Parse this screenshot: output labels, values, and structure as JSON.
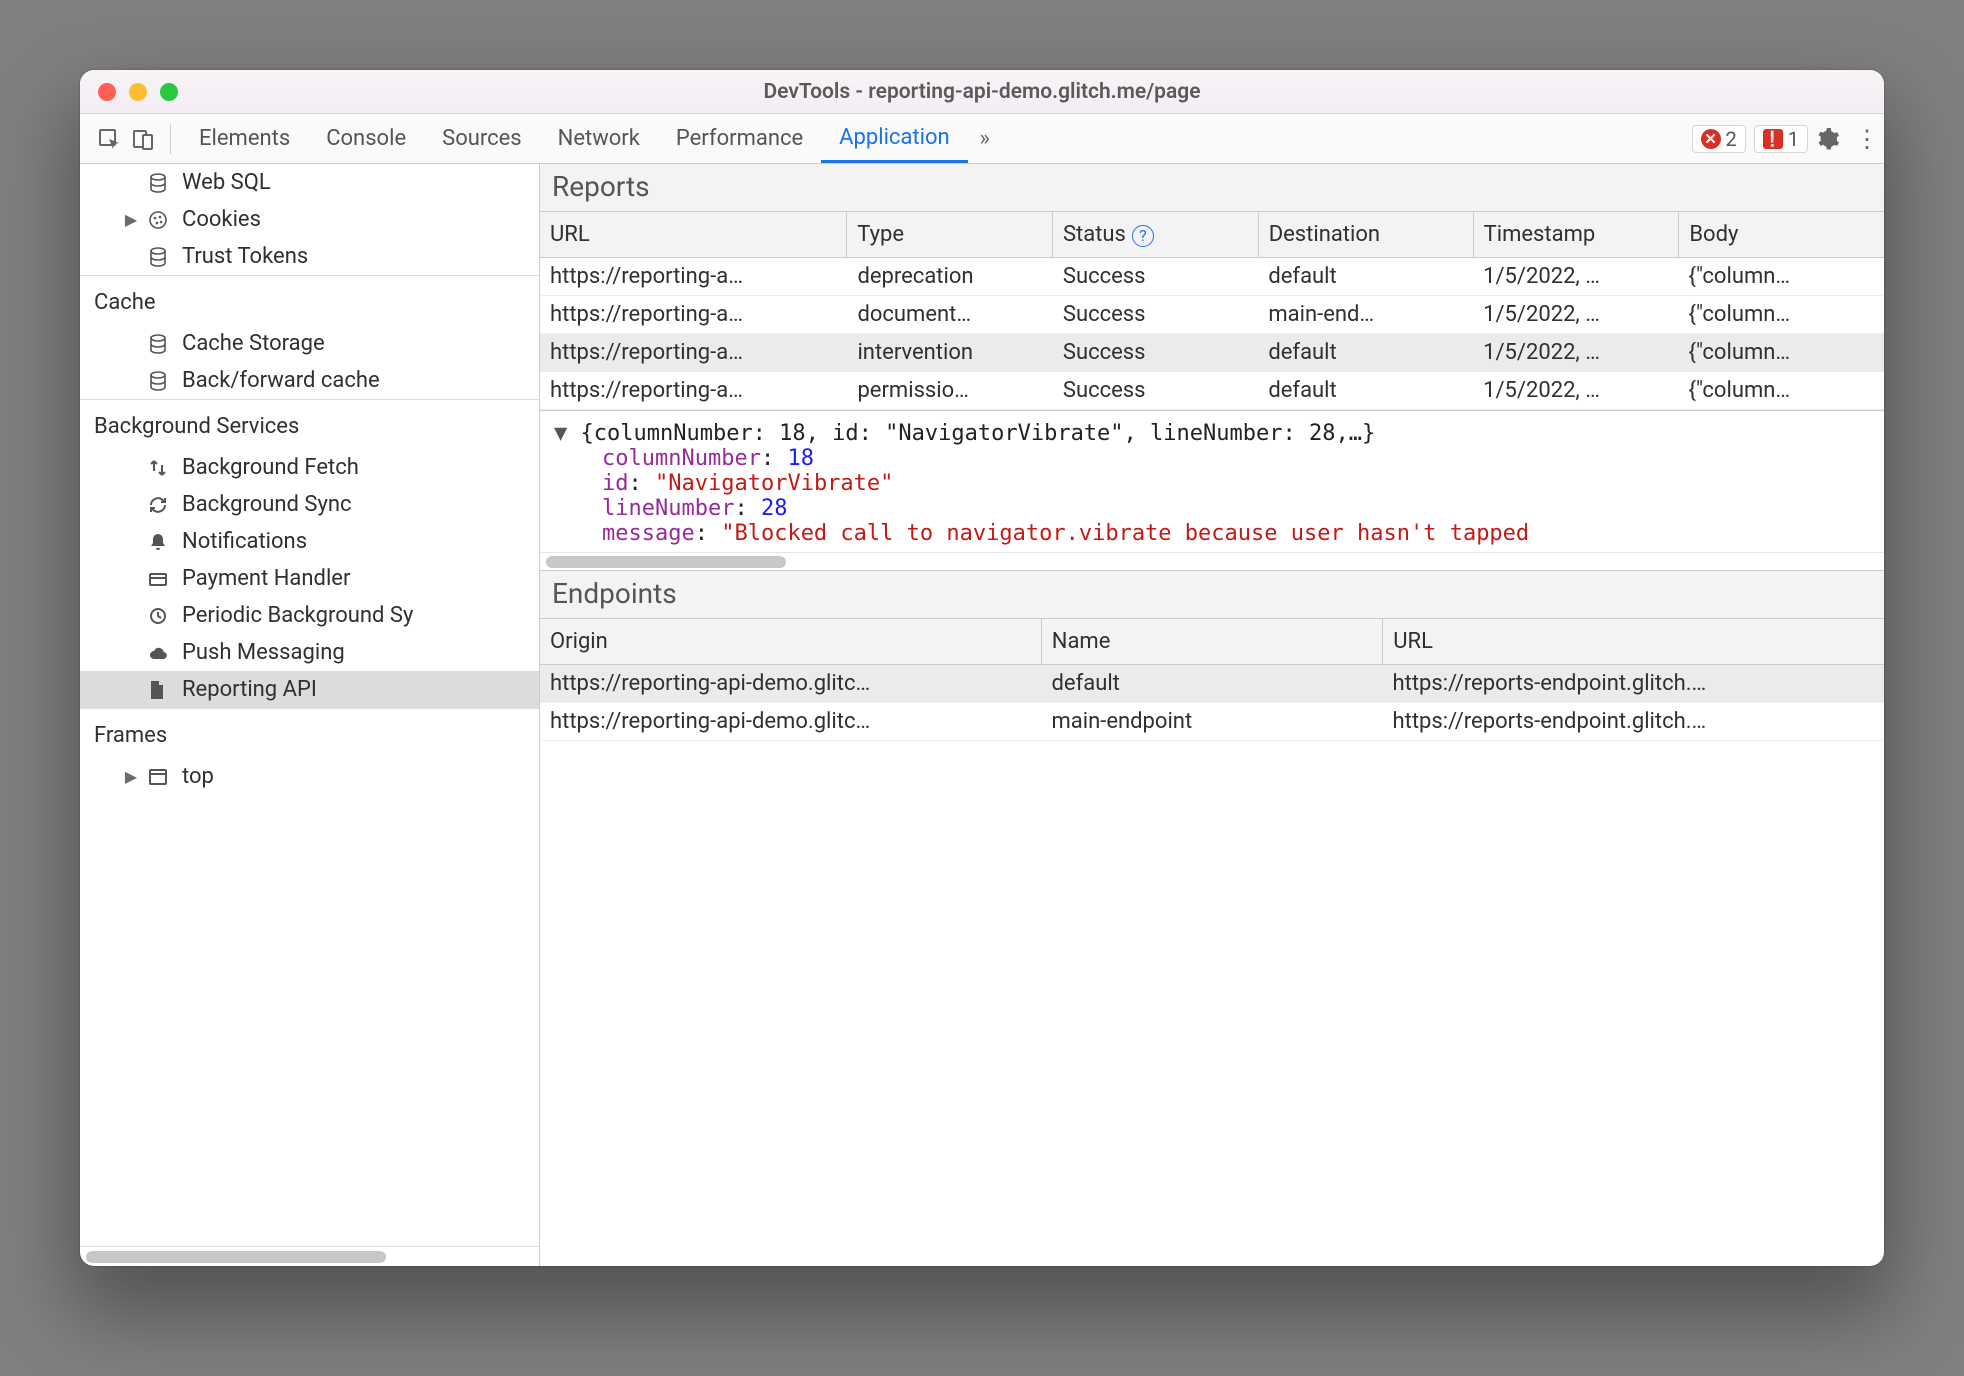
{
  "window": {
    "title": "DevTools - reporting-api-demo.glitch.me/page"
  },
  "toolbar": {
    "tabs": [
      "Elements",
      "Console",
      "Sources",
      "Network",
      "Performance",
      "Application"
    ],
    "active_tab": "Application",
    "errors_count": "2",
    "issues_count": "1"
  },
  "sidebar": {
    "top_items": [
      {
        "icon": "database-icon",
        "label": "Web SQL"
      },
      {
        "icon": "cookie-icon",
        "label": "Cookies",
        "expandable": true
      },
      {
        "icon": "database-icon",
        "label": "Trust Tokens"
      }
    ],
    "groups": [
      {
        "title": "Cache",
        "items": [
          {
            "icon": "database-icon",
            "label": "Cache Storage"
          },
          {
            "icon": "database-icon",
            "label": "Back/forward cache"
          }
        ]
      },
      {
        "title": "Background Services",
        "items": [
          {
            "icon": "updown-icon",
            "label": "Background Fetch"
          },
          {
            "icon": "sync-icon",
            "label": "Background Sync"
          },
          {
            "icon": "bell-icon",
            "label": "Notifications"
          },
          {
            "icon": "card-icon",
            "label": "Payment Handler"
          },
          {
            "icon": "clock-icon",
            "label": "Periodic Background Sy"
          },
          {
            "icon": "cloud-icon",
            "label": "Push Messaging"
          },
          {
            "icon": "file-icon",
            "label": "Reporting API",
            "selected": true
          }
        ]
      },
      {
        "title": "Frames",
        "items": [
          {
            "icon": "frame-icon",
            "label": "top",
            "expandable": true
          }
        ]
      }
    ]
  },
  "reports": {
    "heading": "Reports",
    "columns": [
      "URL",
      "Type",
      "Status",
      "Destination",
      "Timestamp",
      "Body"
    ],
    "rows": [
      {
        "url": "https://reporting-a…",
        "type": "deprecation",
        "status": "Success",
        "dest": "default",
        "ts": "1/5/2022, …",
        "body": "{\"column…"
      },
      {
        "url": "https://reporting-a…",
        "type": "document…",
        "status": "Success",
        "dest": "main-end…",
        "ts": "1/5/2022, …",
        "body": "{\"column…"
      },
      {
        "url": "https://reporting-a…",
        "type": "intervention",
        "status": "Success",
        "dest": "default",
        "ts": "1/5/2022, …",
        "body": "{\"column…",
        "selected": true
      },
      {
        "url": "https://reporting-a…",
        "type": "permissio…",
        "status": "Success",
        "dest": "default",
        "ts": "1/5/2022, …",
        "body": "{\"column…"
      }
    ]
  },
  "details": {
    "summary": "{columnNumber: 18, id: \"NavigatorVibrate\", lineNumber: 28,…}",
    "kv": {
      "columnNumber": "18",
      "id": "\"NavigatorVibrate\"",
      "lineNumber": "28",
      "message": "\"Blocked call to navigator.vibrate because user hasn't tapped"
    }
  },
  "endpoints": {
    "heading": "Endpoints",
    "columns": [
      "Origin",
      "Name",
      "URL"
    ],
    "rows": [
      {
        "origin": "https://reporting-api-demo.glitc…",
        "name": "default",
        "url": "https://reports-endpoint.glitch.…",
        "selected": true
      },
      {
        "origin": "https://reporting-api-demo.glitc…",
        "name": "main-endpoint",
        "url": "https://reports-endpoint.glitch.…"
      }
    ]
  }
}
